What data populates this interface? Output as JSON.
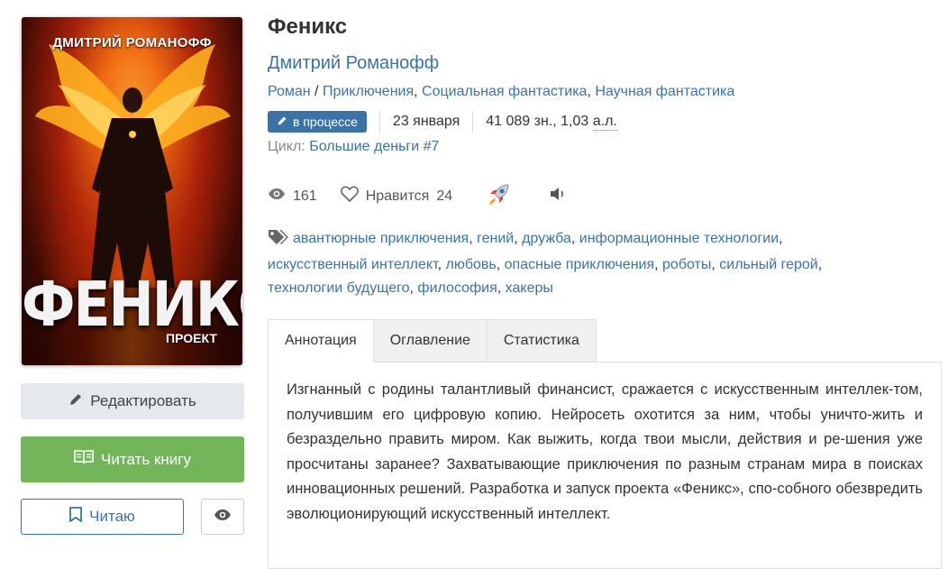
{
  "cover": {
    "author_text": "ДМИТРИЙ РОМАНОФФ",
    "title_text": "ФЕНИКС",
    "subtitle_text": "ПРОЕКТ"
  },
  "buttons": {
    "edit_label": "Редактировать",
    "read_label": "Читать книгу",
    "reading_label": "Читаю"
  },
  "book": {
    "title": "Феникс",
    "author": "Дмитрий Романофф",
    "genres": [
      {
        "label": "Роман",
        "sep": " / "
      },
      {
        "label": "Приключения",
        "sep": ", "
      },
      {
        "label": "Социальная фантастика",
        "sep": ", "
      },
      {
        "label": "Научная фантастика",
        "sep": ""
      }
    ],
    "status": "в процессе",
    "date": "23 января",
    "size_chars": "41 089 зн., 1,03",
    "size_unit": "а.л.",
    "cycle_label": "Цикл:",
    "cycle_name": "Большие деньги",
    "cycle_number": "#7"
  },
  "stats": {
    "views": "161",
    "likes_label": "Нравится",
    "likes_count": "24"
  },
  "tags": [
    "авантюрные приключения",
    "гений",
    "дружба",
    "информационные технологии",
    "искусственный интеллект",
    "любовь",
    "опасные приключения",
    "роботы",
    "сильный герой",
    "технологии будущего",
    "философия",
    "хакеры"
  ],
  "tabs": [
    "Аннотация",
    "Оглавление",
    "Статистика"
  ],
  "annotation": "Изгнанный с родины талантливый финансист, сражается с искусственным интеллек-том, получившим его цифровую копию. Нейросеть охотится за ним, чтобы уничто-жить и безраздельно править миром. Как выжить, когда твои мысли, действия и ре-шения уже просчитаны заранее? Захватывающие приключения по разным странам мира в поисках инновационных решений. Разработка и запуск проекта «Феникс», спо-собного обезвредить эволюционирующий искусственный интеллект.",
  "colors": {
    "link": "#3b73a7",
    "read_button": "#73b65a",
    "status_badge": "#3b73a7"
  }
}
